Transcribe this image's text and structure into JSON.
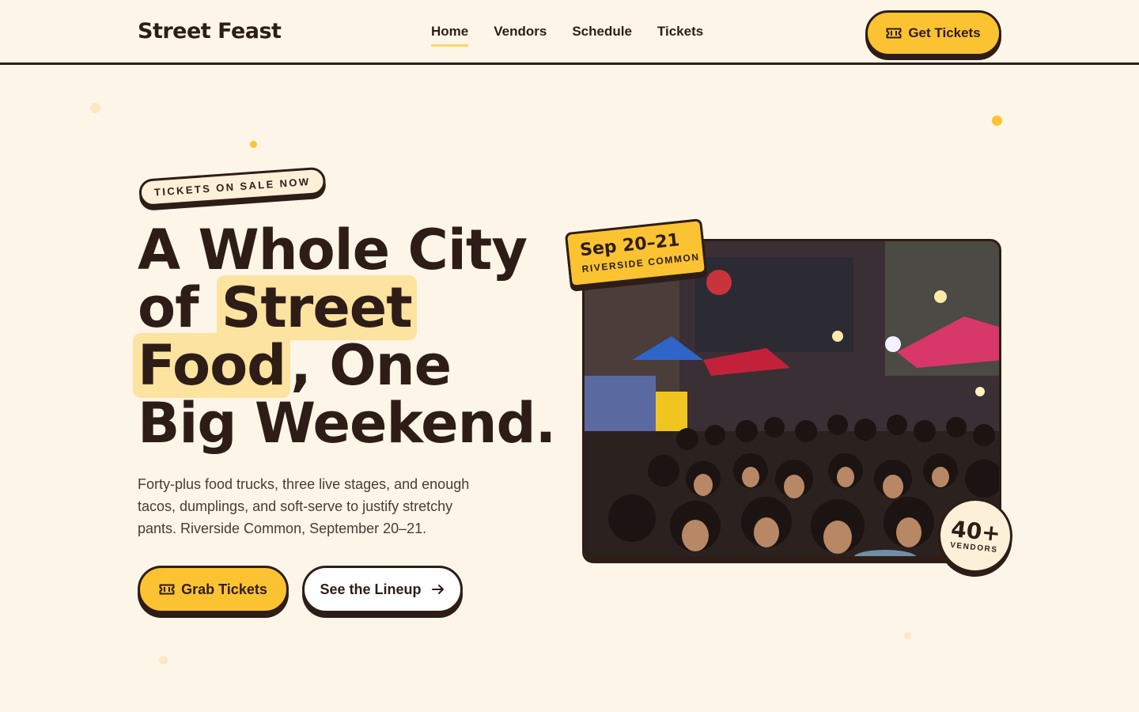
{
  "header": {
    "logo": "Street Feast",
    "nav": [
      {
        "label": "Home",
        "active": true
      },
      {
        "label": "Vendors",
        "active": false
      },
      {
        "label": "Schedule",
        "active": false
      },
      {
        "label": "Tickets",
        "active": false
      }
    ],
    "cta_label": "Get Tickets",
    "cta_icon": "ticket-icon"
  },
  "hero": {
    "badge": "TICKETS ON SALE NOW",
    "headline": {
      "line1": "A Whole City",
      "line2_pre": "of ",
      "line2_hl": "Street",
      "line3_hl": "Food",
      "line3_post": ", One",
      "line4": "Big Weekend."
    },
    "lead": "Forty-plus food trucks, three live stages, and enough tacos, dumplings, and soft-serve to justify stretchy pants. Riverside Common, September 20–21.",
    "primary_button": "Grab Tickets",
    "secondary_button": "See the Lineup",
    "secondary_icon": "arrow-right-icon"
  },
  "photo_card": {
    "photo": "crowded-night-market-photo",
    "date_tag": {
      "date": "Sep 20–21",
      "location": "RIVERSIDE COMMON"
    },
    "vendors_badge": {
      "count": "40+",
      "label": "VENDORS"
    }
  },
  "colors": {
    "background": "#fdf6e8",
    "ink": "#2e1d17",
    "accent": "#fbc331",
    "highlight": "#fde3a0"
  }
}
